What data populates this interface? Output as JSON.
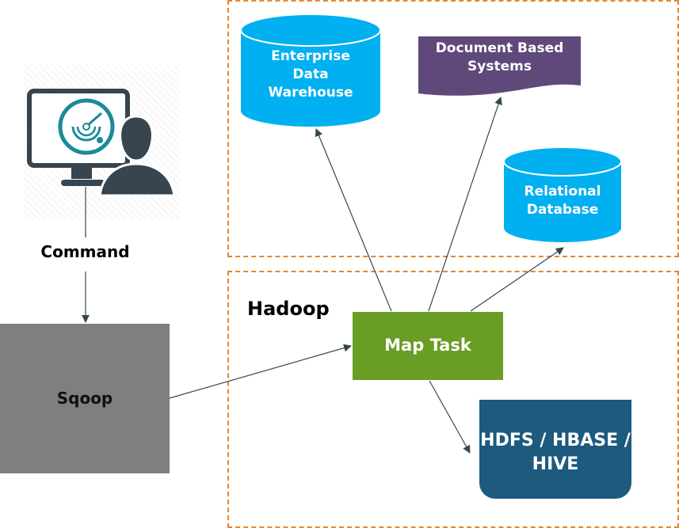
{
  "user": {
    "label": "Command"
  },
  "sqoop": {
    "label": "Sqoop"
  },
  "hadoop": {
    "title": "Hadoop"
  },
  "map_task": {
    "label": "Map Task"
  },
  "hdfs": {
    "label_line1": "HDFS / HBASE /",
    "label_line2": "HIVE"
  },
  "targets": {
    "edw": {
      "line1": "Enterprise",
      "line2": "Data",
      "line3": "Warehouse"
    },
    "docs": {
      "line1": "Document Based",
      "line2": "Systems"
    },
    "rdb": {
      "line1": "Relational",
      "line2": "Database"
    }
  },
  "colors": {
    "border": "#e8862a",
    "cylinder": "#00b0f0",
    "document": "#5f497a",
    "map_task": "#6a9d24",
    "sqoop": "#7f7f7f",
    "hdfs": "#1d5a7e",
    "icon": "#36454f",
    "radar": "#1b8a98",
    "arrow": "#37474f"
  }
}
